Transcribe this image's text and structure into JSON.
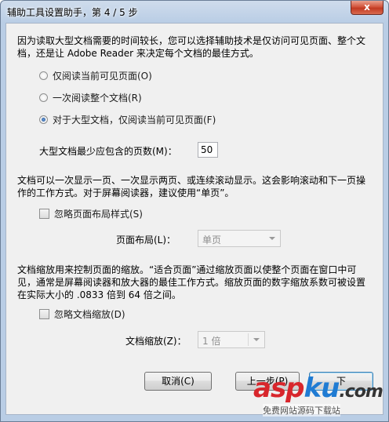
{
  "window": {
    "title": "辅助工具设置助手，第 4 / 5 步",
    "close_label": "x"
  },
  "section1": {
    "description": "因为读取大型文档需要的时间较长，您可以选择辅助技术是仅访问可见页面、整个文档，还是让 Adobe Reader 来决定每个文档的最佳方式。",
    "options": [
      {
        "label": "仅阅读当前可见页面(O)",
        "checked": false
      },
      {
        "label": "一次阅读整个文档(R)",
        "checked": false
      },
      {
        "label": "对于大型文档，仅阅读当前可见页面(F)",
        "checked": true
      }
    ],
    "min_pages_label": "大型文档最少应包含的页数(M)：",
    "min_pages_value": "50"
  },
  "section2": {
    "description": "文档可以一次显示一页、一次显示两页、或连续滚动显示。这会影响滚动和下一页操作的工作方式。对于屏幕阅读器，建议使用“单页”。",
    "ignore_layout_label": "忽略页面布局样式(S)",
    "ignore_layout_checked": false,
    "page_layout_label": "页面布局(L)：",
    "page_layout_value": "单页"
  },
  "section3": {
    "description": "文档缩放用来控制页面的缩放。“适合页面”通过缩放页面以使整个页面在窗口中可见，通常是屏幕阅读器和放大器的最佳工作方式。缩放页面的数字缩放系数可被设置在实际大小的 .0833 倍到 64 倍之间。",
    "ignore_zoom_label": "忽略文档缩放(D)",
    "ignore_zoom_checked": false,
    "zoom_label": "文档缩放(Z)：",
    "zoom_value": "1 倍"
  },
  "buttons": {
    "cancel": "取消(C)",
    "back": "上一步(P)",
    "next": "下"
  },
  "watermark": {
    "brand_red": "asp",
    "brand_blue": "ku",
    "brand_dot": ".",
    "brand_tail": "com",
    "subtitle": "免费网站源码下载站"
  }
}
